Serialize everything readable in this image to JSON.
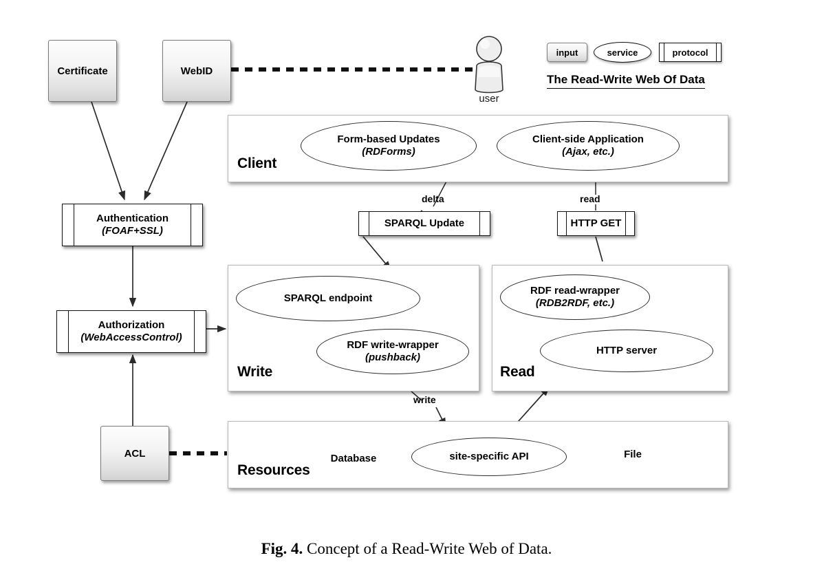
{
  "figure": {
    "caption_label": "Fig. 4.",
    "caption_text": " Concept of a Read-Write Web of Data."
  },
  "legend": {
    "title": "The Read-Write Web Of Data",
    "items": [
      {
        "shape": "input",
        "label": "input"
      },
      {
        "shape": "service",
        "label": "service"
      },
      {
        "shape": "protocol",
        "label": "protocol"
      }
    ]
  },
  "actor": {
    "icon": "user-icon",
    "label": "user"
  },
  "inputs": [
    {
      "id": "certificate",
      "label": "Certificate"
    },
    {
      "id": "webid",
      "label": "WebID"
    },
    {
      "id": "acl",
      "label": "ACL"
    }
  ],
  "security": [
    {
      "id": "authentication",
      "title": "Authentication",
      "subtitle": "(FOAF+SSL)"
    },
    {
      "id": "authorization",
      "title": "Authorization",
      "subtitle": "(WebAccessControl)"
    }
  ],
  "protocols": [
    {
      "id": "sparql-update",
      "label": "SPARQL Update",
      "flow": "delta"
    },
    {
      "id": "http-get",
      "label": "HTTP GET",
      "flow": "read"
    }
  ],
  "panels": {
    "client": {
      "label": "Client",
      "services": [
        {
          "id": "form-based-updates",
          "title": "Form-based Updates",
          "subtitle": "(RDForms)"
        },
        {
          "id": "client-side-application",
          "title": "Client-side Application",
          "subtitle": "(Ajax, etc.)"
        }
      ]
    },
    "write": {
      "label": "Write",
      "services": [
        {
          "id": "sparql-endpoint",
          "title": "SPARQL endpoint",
          "subtitle": ""
        },
        {
          "id": "rdf-write-wrapper",
          "title": "RDF write-wrapper",
          "subtitle": "(pushback)"
        }
      ]
    },
    "read": {
      "label": "Read",
      "services": [
        {
          "id": "rdf-read-wrapper",
          "title": "RDF read-wrapper",
          "subtitle": "(RDB2RDF, etc.)"
        },
        {
          "id": "http-server",
          "title": "HTTP server",
          "subtitle": ""
        }
      ]
    },
    "resources": {
      "label": "Resources",
      "items": [
        {
          "id": "database",
          "label": "Database",
          "glyph": "cylinder-icon"
        },
        {
          "id": "site-specific-api",
          "label": "site-specific API",
          "glyph": "ellipse"
        },
        {
          "id": "file",
          "label": "File",
          "glyph": "document-icon"
        }
      ]
    }
  },
  "flows": [
    {
      "id": "write-flow",
      "label": "write"
    }
  ],
  "colors": {
    "line": "#2b2b2b",
    "panel_border": "#b9b9b9",
    "box_border": "#111111",
    "background": "#ffffff"
  }
}
